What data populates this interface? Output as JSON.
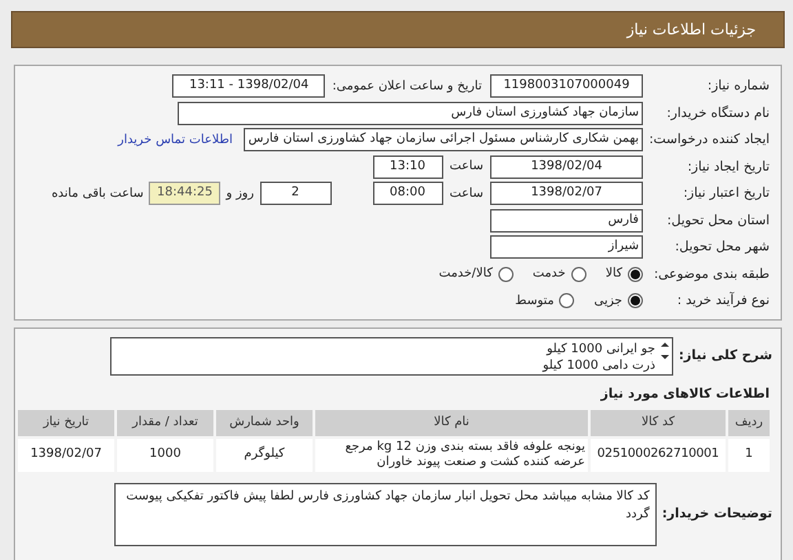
{
  "header": {
    "title": "جزئیات اطلاعات نیاز"
  },
  "need_number": {
    "label": "شماره نیاز:",
    "value": "1198003107000049"
  },
  "announce": {
    "label": "تاریخ و ساعت اعلان عمومی:",
    "value": "1398/02/04 - 13:11"
  },
  "buyer_org": {
    "label": "نام دستگاه خریدار:",
    "value": "سازمان جهاد کشاورزی استان فارس"
  },
  "requester": {
    "label": "ایجاد کننده درخواست:",
    "value": "بهمن شکاری کارشناس مسئول اجرائی سازمان جهاد کشاورزی استان فارس",
    "contact_link": "اطلاعات تماس خریدار"
  },
  "created": {
    "label": "تاریخ ایجاد نیاز:",
    "date": "1398/02/04",
    "time_label": "ساعت",
    "time": "13:10"
  },
  "validity": {
    "label": "تاریخ اعتبار نیاز:",
    "date": "1398/02/07",
    "time_label": "ساعت",
    "time": "08:00",
    "days": "2",
    "days_label": "روز و",
    "remaining": "18:44:25",
    "remaining_label": "ساعت باقی مانده"
  },
  "province": {
    "label": "استان محل تحویل:",
    "value": "فارس"
  },
  "city": {
    "label": "شهر محل تحویل:",
    "value": "شیراز"
  },
  "category": {
    "label": "طبقه بندی موضوعی:",
    "options": [
      {
        "label": "کالا",
        "selected": true
      },
      {
        "label": "خدمت",
        "selected": false
      },
      {
        "label": "کالا/خدمت",
        "selected": false
      }
    ]
  },
  "process": {
    "label": "نوع فرآیند خرید :",
    "options": [
      {
        "label": "جزیی",
        "selected": true
      },
      {
        "label": "متوسط",
        "selected": false
      }
    ]
  },
  "description": {
    "label": "شرح کلی نیاز:",
    "lines": [
      "جو ایرانی 1000 کیلو",
      "ذرت دامی 1000 کیلو"
    ]
  },
  "goods": {
    "title": "اطلاعات کالاهای مورد نیاز",
    "columns": [
      "ردیف",
      "کد کالا",
      "نام کالا",
      "واحد شمارش",
      "تعداد / مقدار",
      "تاریخ نیاز"
    ],
    "rows": [
      [
        "1",
        "0251000262710001",
        "یونجه علوفه فاقد بسته بندی وزن 12 kg مرجع عرضه کننده کشت و صنعت پیوند خاوران",
        "کیلوگرم",
        "1000",
        "1398/02/07"
      ]
    ]
  },
  "buyer_notes": {
    "label": "توضیحات خریدار:",
    "value": "کد کالا مشابه میباشد محل تحویل انبار سازمان جهاد کشاورزی فارس لطفا پیش فاکتور تفکیکی پیوست گردد"
  }
}
